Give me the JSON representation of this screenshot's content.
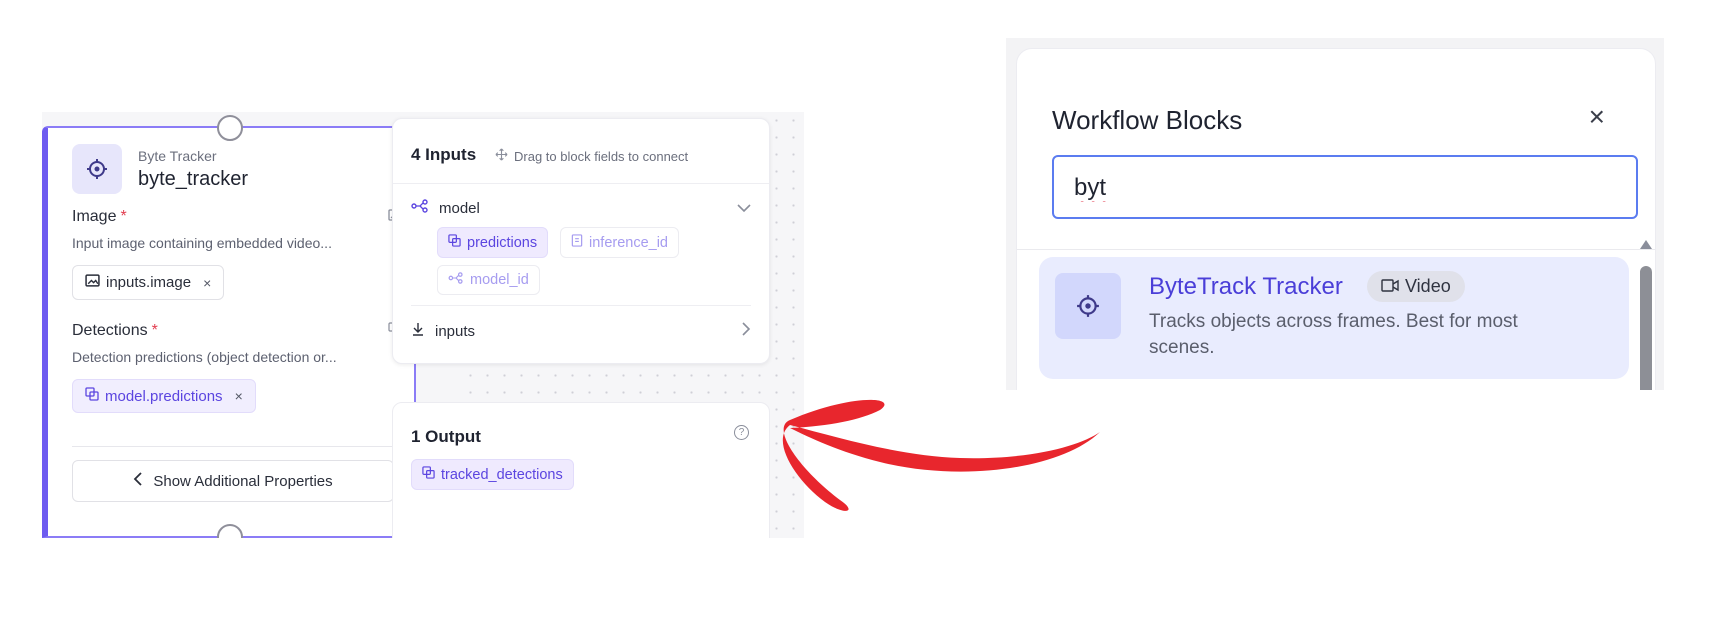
{
  "block": {
    "type_label": "Byte Tracker",
    "name": "byte_tracker",
    "image_label": "Image",
    "image_required": "*",
    "image_desc": "Input image containing embedded video...",
    "image_chip": "inputs.image",
    "detections_label": "Detections",
    "detections_required": "*",
    "detections_desc": "Detection predictions (object detection or...",
    "detections_chip": "model.predictions",
    "chip_remove": "×",
    "show_more_label": "Show Additional Properties"
  },
  "inputs_panel": {
    "title": "4 Inputs",
    "hint": "Drag to block fields to connect",
    "model_label": "model",
    "ports": [
      "predictions",
      "inference_id",
      "model_id"
    ],
    "inputs_label": "inputs"
  },
  "outputs_panel": {
    "title": "1 Output",
    "help": "?",
    "port": "tracked_detections"
  },
  "workflow_blocks": {
    "title": "Workflow Blocks",
    "close": "×",
    "search_value": "byt",
    "result": {
      "title": "ByteTrack Tracker",
      "badge": "Video",
      "description": "Tracks objects across frames. Best for most scenes."
    }
  },
  "colors": {
    "accent_purple": "#6e5bf0",
    "result_bg": "#e9ecfe",
    "arrow_red": "#e8262d"
  }
}
